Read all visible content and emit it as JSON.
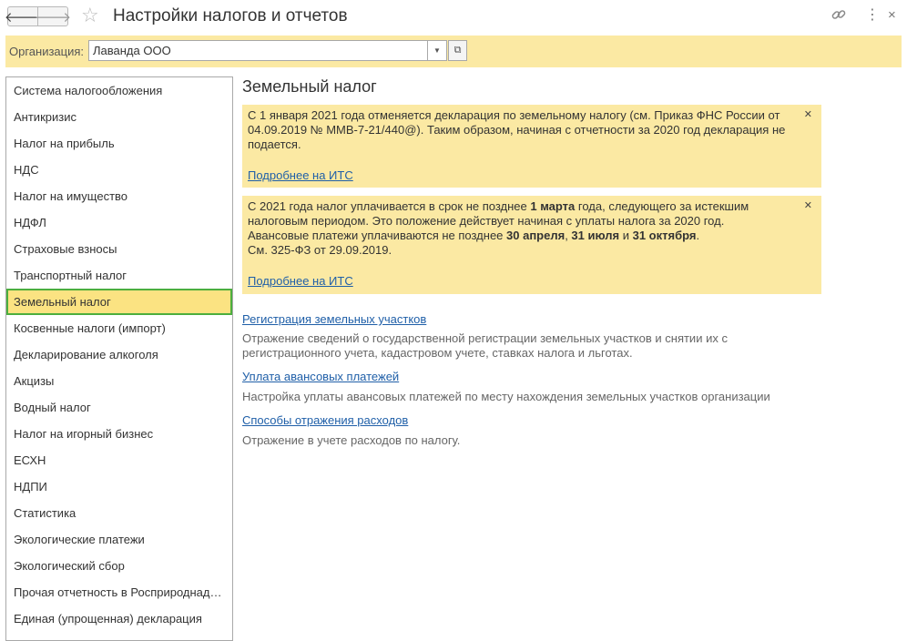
{
  "window": {
    "title": "Настройки налогов и отчетов",
    "back_icon": "arrow-left-icon",
    "forward_icon": "arrow-right-icon",
    "favorite_icon": "star-icon",
    "link_icon": "link-icon",
    "more_icon": "more-vertical-icon",
    "close_icon": "close-icon"
  },
  "organization": {
    "label": "Организация:",
    "value": "Лаванда ООО"
  },
  "sidebar": {
    "items": [
      {
        "label": "Система налогообложения"
      },
      {
        "label": "Антикризис"
      },
      {
        "label": "Налог на прибыль"
      },
      {
        "label": "НДС"
      },
      {
        "label": "Налог на имущество"
      },
      {
        "label": "НДФЛ"
      },
      {
        "label": "Страховые взносы"
      },
      {
        "label": "Транспортный налог"
      },
      {
        "label": "Земельный налог",
        "active": true
      },
      {
        "label": "Косвенные налоги (импорт)"
      },
      {
        "label": "Декларирование алкоголя"
      },
      {
        "label": "Акцизы"
      },
      {
        "label": "Водный налог"
      },
      {
        "label": "Налог на игорный бизнес"
      },
      {
        "label": "ЕСХН"
      },
      {
        "label": "НДПИ"
      },
      {
        "label": "Статистика"
      },
      {
        "label": "Экологические платежи"
      },
      {
        "label": "Экологический сбор"
      },
      {
        "label": "Прочая отчетность в Росприроднад…"
      },
      {
        "label": "Единая (упрощенная) декларация"
      }
    ]
  },
  "main": {
    "title": "Земельный налог",
    "notice1": {
      "line1": "С 1 января 2021 года отменяется декларация по земельному налогу (см. Приказ ФНС России от",
      "line2": "04.09.2019 № ММВ-7-21/440@). Таким образом, начиная с отчетности за 2020 год декларация не",
      "line3": "подается.",
      "link": "Подробнее на ИТС"
    },
    "notice2": {
      "l1a": "С 2021 года налог уплачивается в срок не позднее ",
      "l1b": "1 марта",
      "l1c": " года, следующего за истекшим",
      "l2": "налоговым периодом. Это положение действует начиная с уплаты налога за 2020 год.",
      "l3a": "Авансовые платежи уплачиваются не позднее ",
      "l3b": "30 апреля",
      "l3c": ", ",
      "l3d": "31 июля",
      "l3e": " и ",
      "l3f": "31 октября",
      "l3g": ".",
      "l4": "См. 325-ФЗ от 29.09.2019.",
      "link": "Подробнее на ИТС"
    },
    "sections": [
      {
        "link": "Регистрация земельных участков",
        "desc1": "Отражение сведений о государственной регистрации земельных участков и снятии их с",
        "desc2": "регистрационного учета, кадастровом учете, ставках налога и льготах."
      },
      {
        "link": "Уплата авансовых платежей",
        "desc1": "Настройка уплаты авансовых платежей по месту нахождения земельных участков организации",
        "desc2": ""
      },
      {
        "link": "Способы отражения расходов",
        "desc1": "Отражение в учете расходов по налогу.",
        "desc2": ""
      }
    ]
  }
}
